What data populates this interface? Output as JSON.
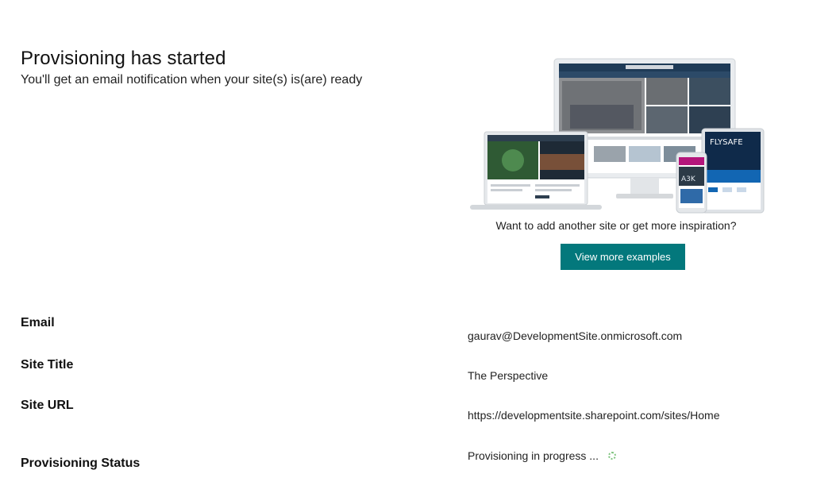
{
  "header": {
    "title": "Provisioning has started",
    "subtitle": "You'll get an email notification when your site(s) is(are) ready"
  },
  "inspiration": {
    "text": "Want to add another site or get more inspiration?",
    "button_label": "View more examples",
    "accent_color": "#03787c",
    "image_text": {
      "brand": "FLYSAFE",
      "tile_text": "A3K"
    }
  },
  "details": {
    "email_label": "Email",
    "email_value": "gaurav@DevelopmentSite.onmicrosoft.com",
    "site_title_label": "Site Title",
    "site_title_value": "The Perspective",
    "site_url_label": "Site URL",
    "site_url_value": "https://developmentsite.sharepoint.com/sites/Home",
    "status_label": "Provisioning Status",
    "status_value": "Provisioning in progress ...",
    "status_icon": "loading-spinner-icon"
  }
}
